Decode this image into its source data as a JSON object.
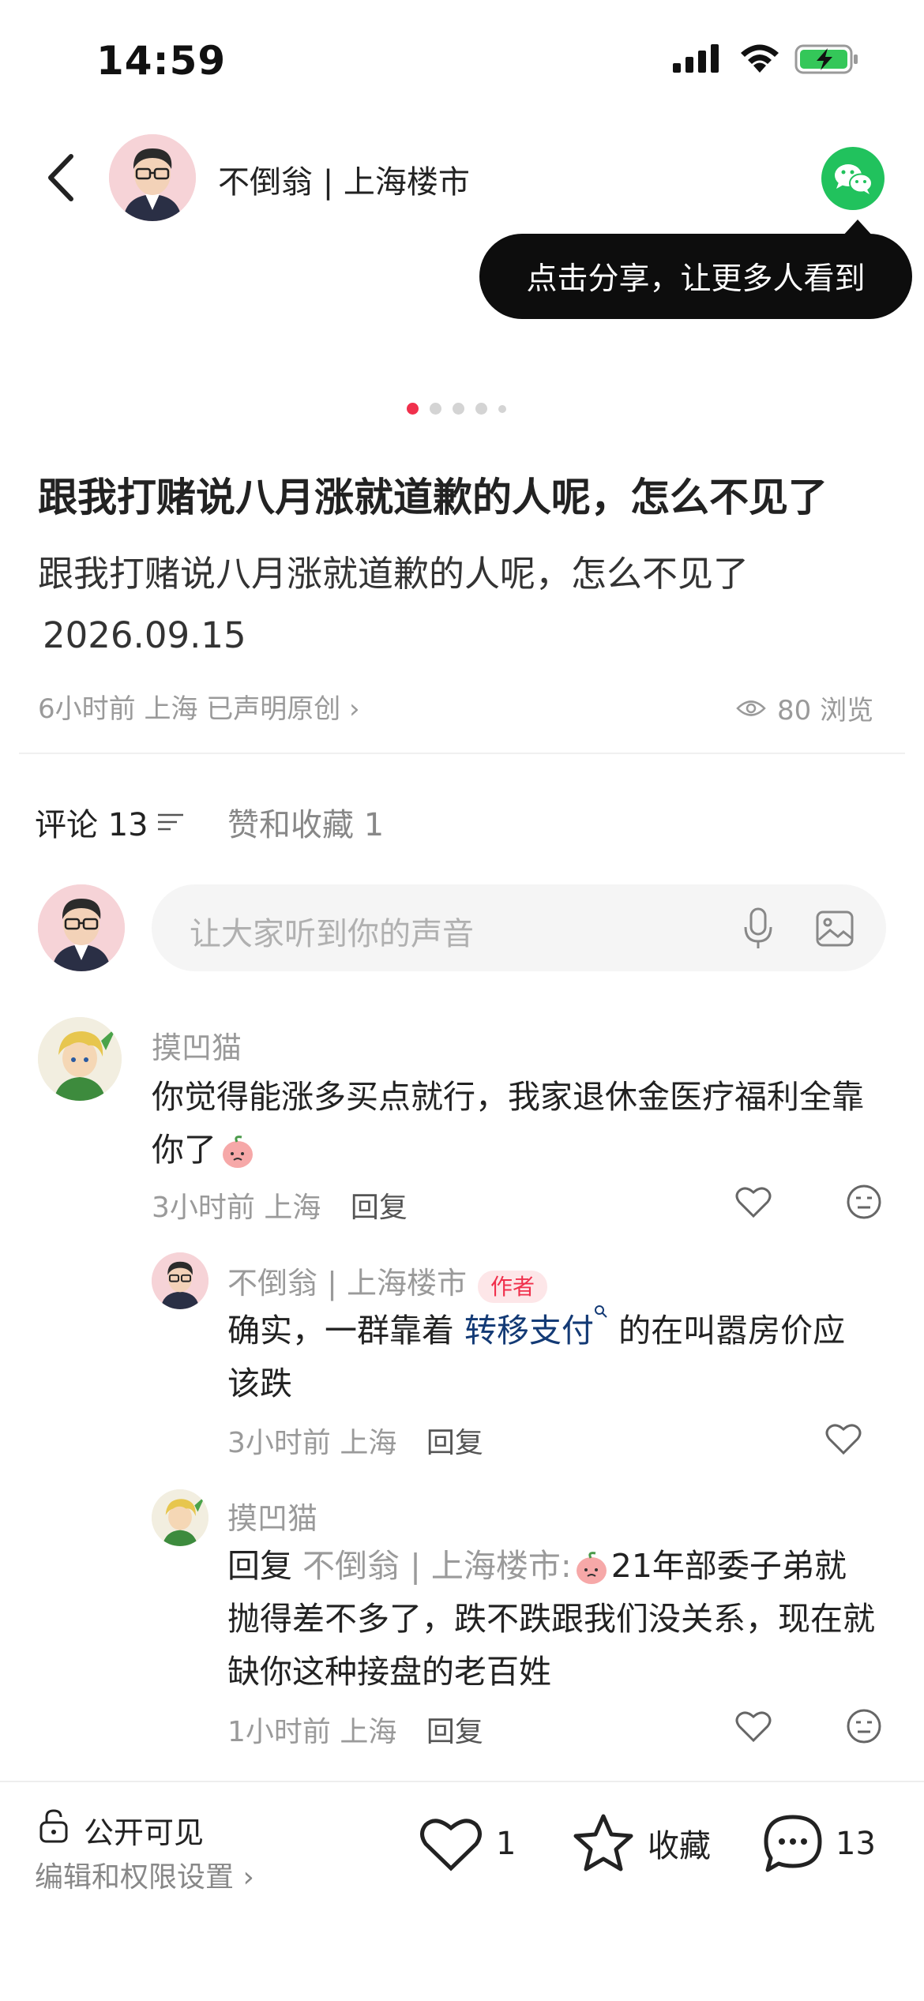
{
  "status_bar": {
    "time": "14:59"
  },
  "header": {
    "author": "不倒翁 | 上海楼市",
    "tooltip": "点击分享，让更多人看到"
  },
  "post": {
    "title": "跟我打赌说八月涨就道歉的人呢，怎么不见了",
    "body_line1": "跟我打赌说八月涨就道歉的人呢，怎么不见了",
    "body_line2": "2026.09.15",
    "meta": "6小时前 上海 已声明原创 ›",
    "views": "80 浏览",
    "image_count": 5,
    "current_image": 1
  },
  "tabs": {
    "comments": "评论 13",
    "likes": "赞和收藏 1"
  },
  "comment_input": {
    "placeholder": "让大家听到你的声音"
  },
  "comments": [
    {
      "name": "摸凹猫",
      "text_line1": "你觉得能涨多买点就行，我家退休金医疗福利全靠",
      "text_line2": "你了",
      "time": "3小时前 上海",
      "reply": "回复"
    },
    {
      "name": "不倒翁 | 上海楼市",
      "tag": "作者",
      "text_pre": "确实，一群靠着",
      "link": "转移支付",
      "text_post": "的在叫嚣房价应",
      "text_line2": "该跌",
      "time": "3小时前 上海",
      "reply": "回复"
    },
    {
      "name": "摸凹猫",
      "reply_prefix": "回复",
      "reply_to": "不倒翁 | 上海楼市:",
      "text_line1": "21年部委子弟就",
      "text_line2": "抛得差不多了，跌不跌跟我们没关系，现在就",
      "text_line3": "缺你这种接盘的老百姓",
      "time": "1小时前 上海",
      "reply": "回复"
    }
  ],
  "bottom_bar": {
    "visibility": "公开可见",
    "edit": "编辑和权限设置 ›",
    "like_count": "1",
    "collect": "收藏",
    "comment_count": "13"
  },
  "colors": {
    "accent": "#f0304c",
    "wechat": "#21c25d",
    "link": "#133a75"
  }
}
